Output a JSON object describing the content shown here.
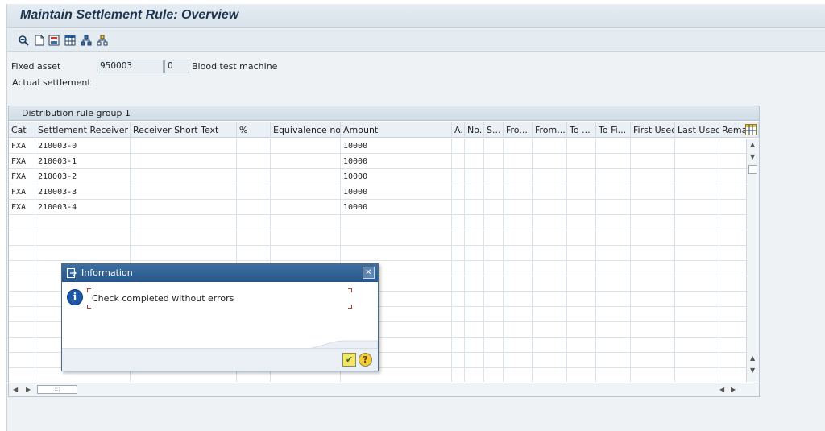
{
  "window": {
    "title": "Maintain Settlement Rule: Overview"
  },
  "toolbar": {
    "icons": [
      "magnifier-icon",
      "new-document-icon",
      "save-layout-icon",
      "grid-icon",
      "hierarchy-icon",
      "tree-icon"
    ]
  },
  "header": {
    "fixed_asset_label": "Fixed asset",
    "asset_number": "950003",
    "sub_number": "0",
    "asset_description": "Blood test machine",
    "settlement_type": "Actual settlement"
  },
  "table": {
    "group_title": "Distribution rule group 1",
    "columns": [
      "Cat",
      "Settlement Receiver",
      "Receiver Short Text",
      "%",
      "Equivalence no.",
      "Amount",
      "A..",
      "No.",
      "S...",
      "Fro...",
      "From...",
      "To ...",
      "To Fi...",
      "First Used",
      "Last Used",
      "Rema"
    ],
    "rows": [
      {
        "cat": "FXA",
        "receiver": "210003-0",
        "amount": "10000"
      },
      {
        "cat": "FXA",
        "receiver": "210003-1",
        "amount": "10000"
      },
      {
        "cat": "FXA",
        "receiver": "210003-2",
        "amount": "10000"
      },
      {
        "cat": "FXA",
        "receiver": "210003-3",
        "amount": "10000"
      },
      {
        "cat": "FXA",
        "receiver": "210003-4",
        "amount": "10000"
      }
    ],
    "hscroll_grip": ":::"
  },
  "dialog": {
    "title": "Information",
    "message": "Check completed without errors",
    "ok_symbol": "✔",
    "help_symbol": "?",
    "close_symbol": "✕"
  },
  "colors": {
    "dialog_title_bg": "#27568a",
    "info_icon": "#1d56a8",
    "ok_button": "#f5e66a"
  }
}
